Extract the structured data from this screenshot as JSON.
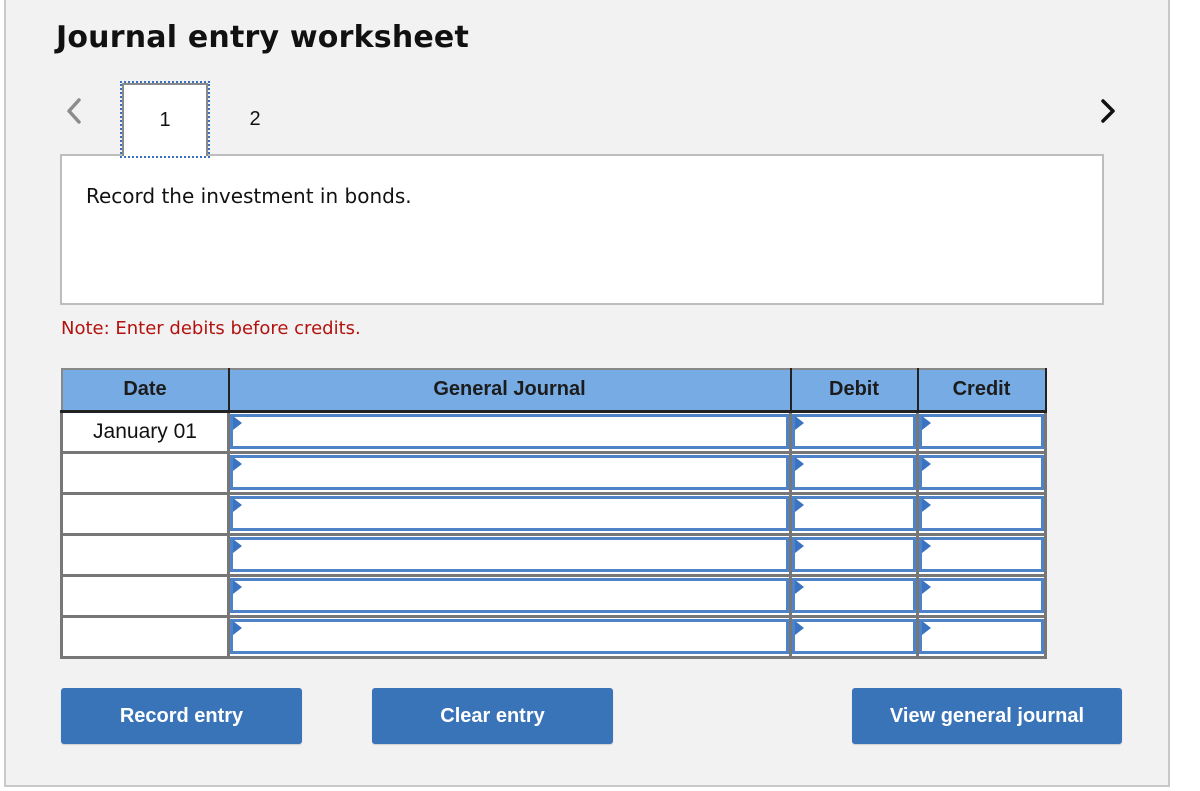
{
  "title": "Journal entry worksheet",
  "navigation": {
    "prev_icon": "chevron-left-icon",
    "next_icon": "chevron-right-icon",
    "tabs": [
      {
        "label": "1",
        "active": true
      },
      {
        "label": "2",
        "active": false
      }
    ]
  },
  "instruction": "Record the investment in bonds.",
  "note": "Note: Enter debits before credits.",
  "table": {
    "headers": {
      "date": "Date",
      "general_journal": "General Journal",
      "debit": "Debit",
      "credit": "Credit"
    },
    "rows": [
      {
        "date": "January 01",
        "account": "",
        "debit": "",
        "credit": ""
      },
      {
        "date": "",
        "account": "",
        "debit": "",
        "credit": ""
      },
      {
        "date": "",
        "account": "",
        "debit": "",
        "credit": ""
      },
      {
        "date": "",
        "account": "",
        "debit": "",
        "credit": ""
      },
      {
        "date": "",
        "account": "",
        "debit": "",
        "credit": ""
      },
      {
        "date": "",
        "account": "",
        "debit": "",
        "credit": ""
      }
    ]
  },
  "buttons": {
    "record": "Record entry",
    "clear": "Clear entry",
    "view": "View general journal"
  },
  "colors": {
    "header_bg": "#77abe3",
    "button_bg": "#3a74b8",
    "note_text": "#b3120f",
    "input_border": "#4e84c7"
  }
}
